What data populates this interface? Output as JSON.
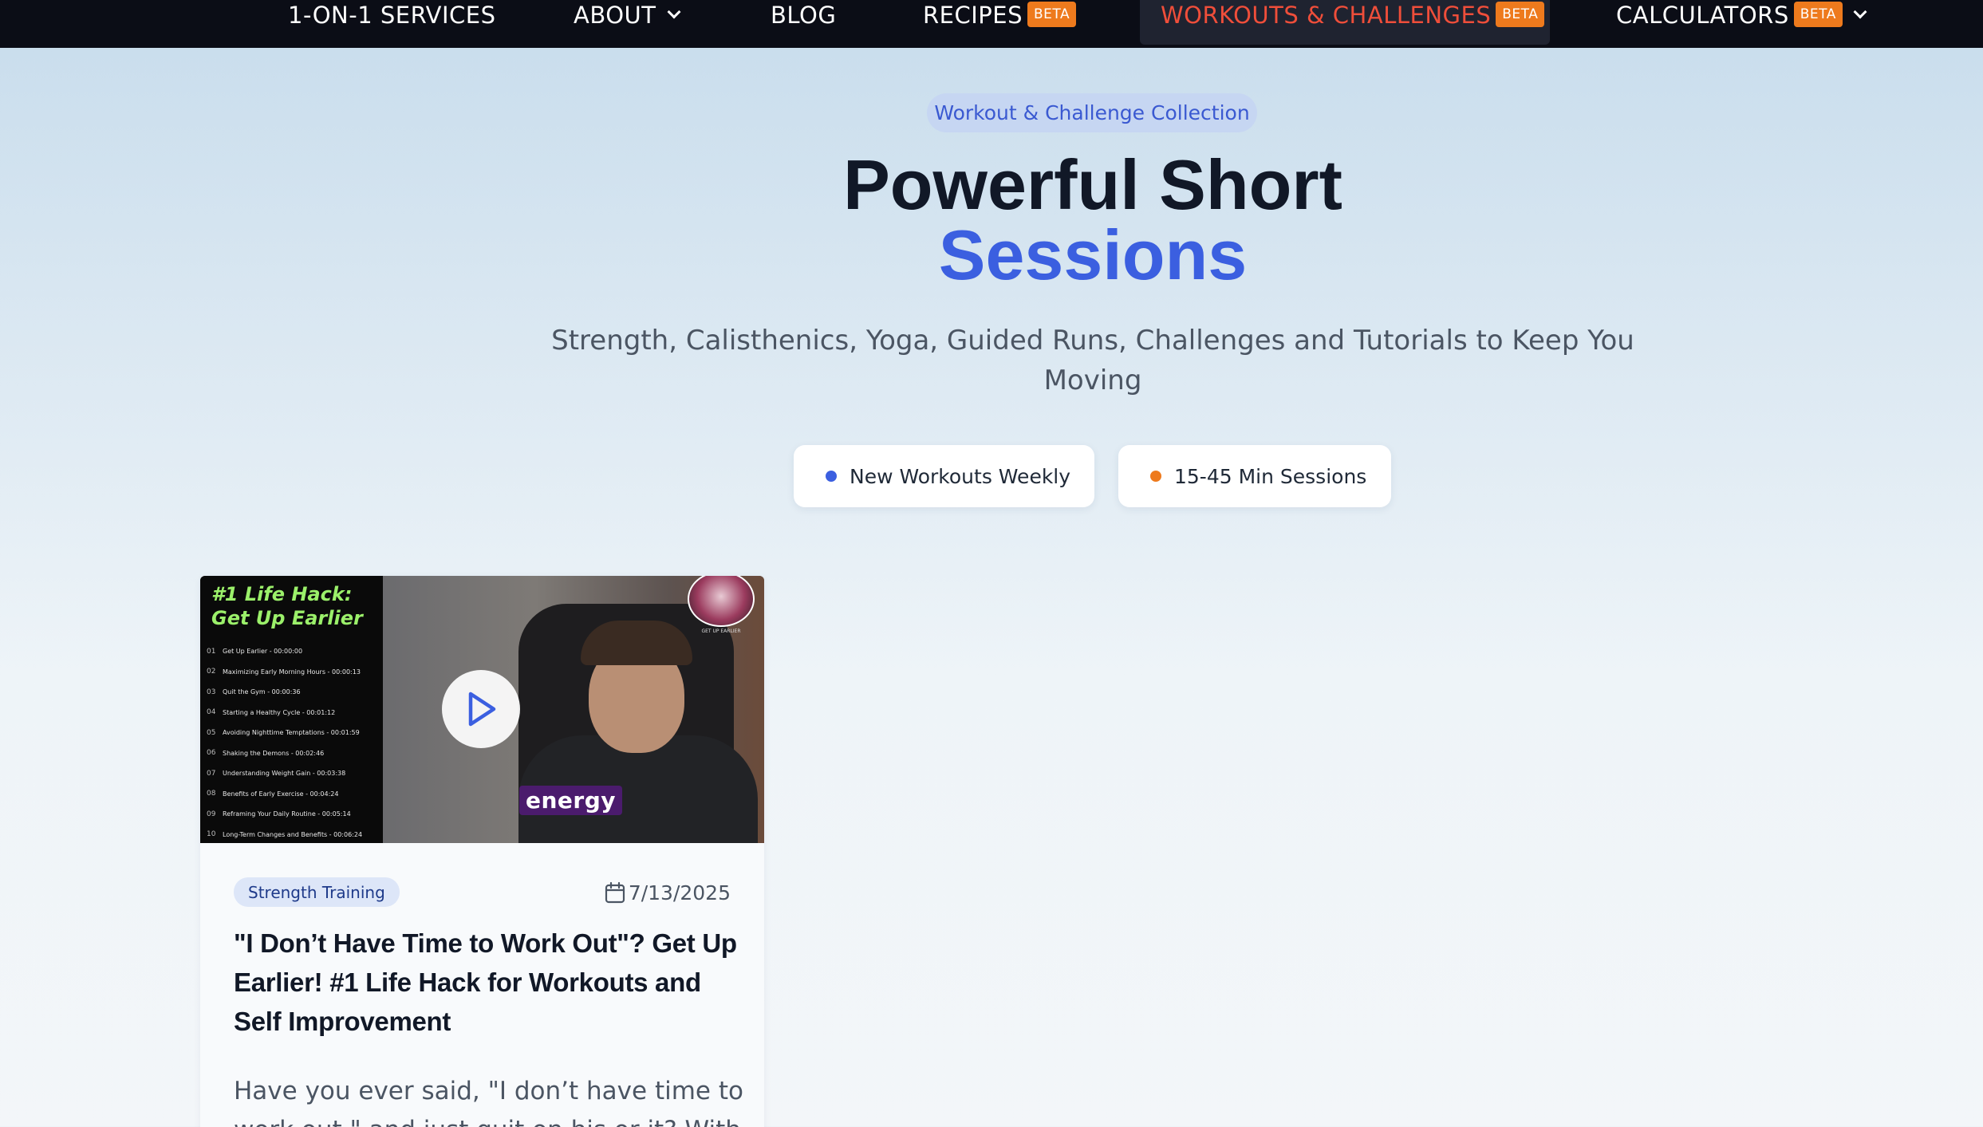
{
  "nav": {
    "items": [
      {
        "label": "1-ON-1 SERVICES"
      },
      {
        "label": "ABOUT"
      },
      {
        "label": "BLOG"
      },
      {
        "label": "RECIPES",
        "badge": "BETA"
      },
      {
        "label": "WORKOUTS & CHALLENGES",
        "badge": "BETA",
        "active": true
      },
      {
        "label": "CALCULATORS",
        "badge": "BETA"
      }
    ]
  },
  "hero": {
    "tag": "Workout & Challenge Collection",
    "title_line1": "Powerful Short",
    "title_line2": "Sessions",
    "subtitle": "Strength, Calisthenics, Yoga, Guided Runs, Challenges and Tutorials to Keep You Moving",
    "features": [
      {
        "label": "New Workouts Weekly",
        "dot_color": "#3b5fe0"
      },
      {
        "label": "15-45 Min Sessions",
        "dot_color": "#ee7a1d"
      }
    ]
  },
  "cards": [
    {
      "thumbnail": {
        "title": "#1 Life Hack: Get Up Earlier",
        "caption": "energy",
        "logo_text": "GET UP EARLIER",
        "chapters": [
          {
            "num": "01",
            "text": "Get Up Earlier - 00:00:00"
          },
          {
            "num": "02",
            "text": "Maximizing Early Morning Hours - 00:00:13"
          },
          {
            "num": "03",
            "text": "Quit the Gym - 00:00:36"
          },
          {
            "num": "04",
            "text": "Starting a Healthy Cycle - 00:01:12"
          },
          {
            "num": "05",
            "text": "Avoiding Nighttime Temptations - 00:01:59"
          },
          {
            "num": "06",
            "text": "Shaking the Demons - 00:02:46"
          },
          {
            "num": "07",
            "text": "Understanding Weight Gain - 00:03:38"
          },
          {
            "num": "08",
            "text": "Benefits of Early Exercise - 00:04:24"
          },
          {
            "num": "09",
            "text": "Reframing Your Daily Routine - 00:05:14"
          },
          {
            "num": "10",
            "text": "Long-Term Changes and Benefits - 00:06:24"
          }
        ]
      },
      "category": "Strength Training",
      "date": "7/13/2025",
      "title": "\"I Don’t Have Time to Work Out\"? Get Up Earlier! #1 Life Hack for Workouts and Self Improvement",
      "excerpt": "Have you ever said, \"I don’t have time to work out,\" and just quit on his or it? With"
    }
  ],
  "colors": {
    "nav_bg": "#0b0d16",
    "accent_blue": "#3b5fe0",
    "active_nav": "#ef4e3a",
    "beta_badge": "#ee7a1d"
  }
}
